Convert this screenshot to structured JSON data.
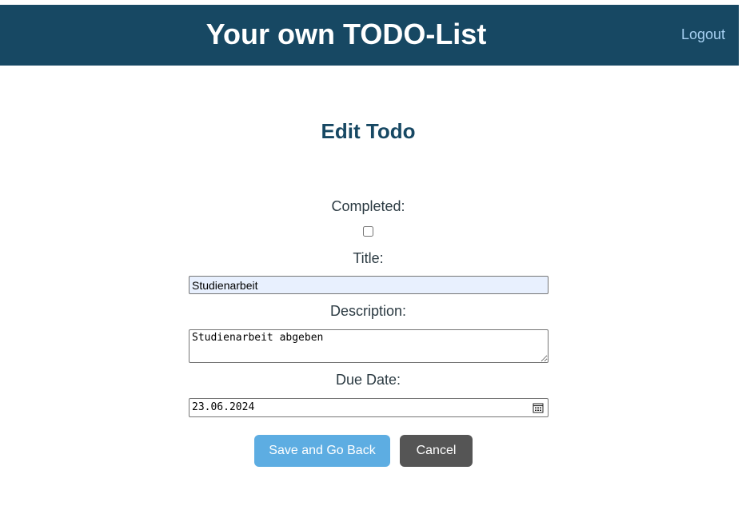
{
  "header": {
    "title": "Your own TODO-List",
    "logout_label": "Logout"
  },
  "page": {
    "title": "Edit Todo"
  },
  "form": {
    "completed_label": "Completed:",
    "completed_checked": false,
    "title_label": "Title:",
    "title_value": "Studienarbeit",
    "description_label": "Description:",
    "description_value": "Studienarbeit abgeben",
    "due_date_label": "Due Date:",
    "due_date_value": "23.06.2024",
    "calendar_icon": "calendar-icon"
  },
  "actions": {
    "save_label": "Save and Go Back",
    "cancel_label": "Cancel"
  },
  "colors": {
    "header_bg": "#174863",
    "logout_link": "#a9d3f5",
    "heading": "#174863",
    "save_button": "#5dade2",
    "cancel_button": "#555555",
    "autofill_bg": "#e8f0fe"
  }
}
